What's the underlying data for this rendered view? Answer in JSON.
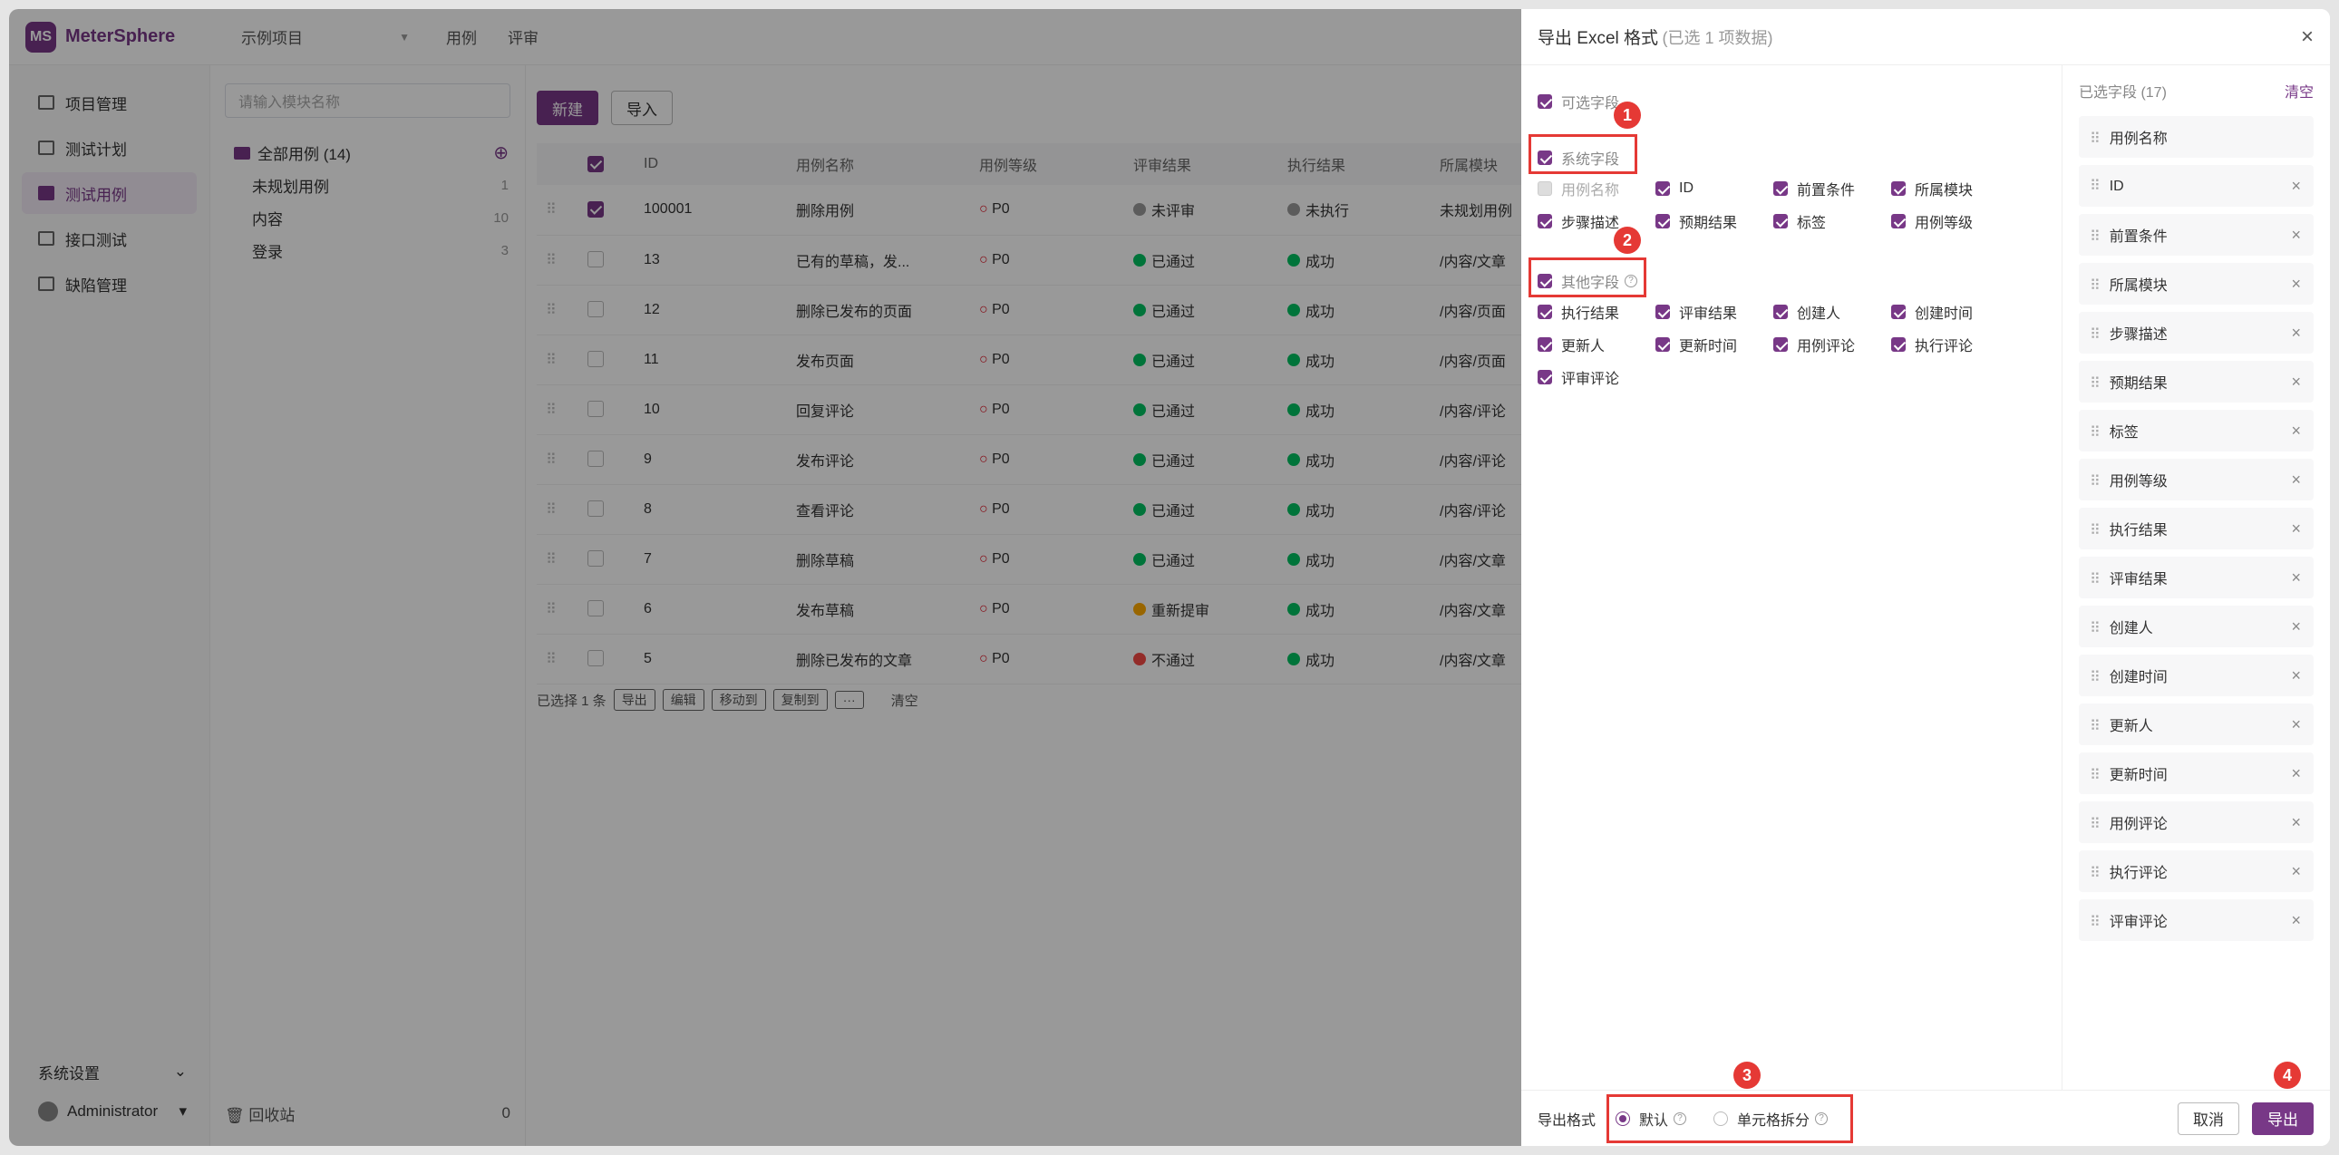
{
  "app": {
    "name": "MeterSphere",
    "logo_text": "MS"
  },
  "header": {
    "project": "示例项目",
    "tabs": [
      "用例",
      "评审"
    ]
  },
  "sidebar": {
    "items": [
      {
        "label": "项目管理",
        "active": false
      },
      {
        "label": "测试计划",
        "active": false
      },
      {
        "label": "测试用例",
        "active": true
      },
      {
        "label": "接口测试",
        "active": false
      },
      {
        "label": "缺陷管理",
        "active": false
      }
    ],
    "settings": "系统设置",
    "user": "Administrator"
  },
  "tree": {
    "search_placeholder": "请输入模块名称",
    "root": "全部用例",
    "root_count": "(14)",
    "nodes": [
      {
        "label": "未规划用例",
        "count": "1"
      },
      {
        "label": "内容",
        "count": "10"
      },
      {
        "label": "登录",
        "count": "3"
      }
    ],
    "recycle": "回收站",
    "recycle_count": "0"
  },
  "toolbar": {
    "new": "新建",
    "import": "导入"
  },
  "table": {
    "headers": [
      "ID",
      "用例名称",
      "用例等级",
      "评审结果",
      "执行结果",
      "所属模块"
    ],
    "rows": [
      {
        "id": "100001",
        "name": "删除用例",
        "level": "P0",
        "review": "未评审",
        "exec": "未执行",
        "module": "未规划用例",
        "checked": true,
        "review_color": "#999",
        "exec_color": "#999"
      },
      {
        "id": "13",
        "name": "已有的草稿，发...",
        "level": "P0",
        "review": "已通过",
        "exec": "成功",
        "module": "/内容/文章",
        "checked": false,
        "review_color": "#00c261",
        "exec_color": "#00c261"
      },
      {
        "id": "12",
        "name": "删除已发布的页面",
        "level": "P0",
        "review": "已通过",
        "exec": "成功",
        "module": "/内容/页面",
        "checked": false,
        "review_color": "#00c261",
        "exec_color": "#00c261"
      },
      {
        "id": "11",
        "name": "发布页面",
        "level": "P0",
        "review": "已通过",
        "exec": "成功",
        "module": "/内容/页面",
        "checked": false,
        "review_color": "#00c261",
        "exec_color": "#00c261"
      },
      {
        "id": "10",
        "name": "回复评论",
        "level": "P0",
        "review": "已通过",
        "exec": "成功",
        "module": "/内容/评论",
        "checked": false,
        "review_color": "#00c261",
        "exec_color": "#00c261"
      },
      {
        "id": "9",
        "name": "发布评论",
        "level": "P0",
        "review": "已通过",
        "exec": "成功",
        "module": "/内容/评论",
        "checked": false,
        "review_color": "#00c261",
        "exec_color": "#00c261"
      },
      {
        "id": "8",
        "name": "查看评论",
        "level": "P0",
        "review": "已通过",
        "exec": "成功",
        "module": "/内容/评论",
        "checked": false,
        "review_color": "#00c261",
        "exec_color": "#00c261"
      },
      {
        "id": "7",
        "name": "删除草稿",
        "level": "P0",
        "review": "已通过",
        "exec": "成功",
        "module": "/内容/文章",
        "checked": false,
        "review_color": "#00c261",
        "exec_color": "#00c261"
      },
      {
        "id": "6",
        "name": "发布草稿",
        "level": "P0",
        "review": "重新提审",
        "exec": "成功",
        "module": "/内容/文章",
        "checked": false,
        "review_color": "#ffaa00",
        "exec_color": "#00c261"
      },
      {
        "id": "5",
        "name": "删除已发布的文章",
        "level": "P0",
        "review": "不通过",
        "exec": "成功",
        "module": "/内容/文章",
        "checked": false,
        "review_color": "#f54a45",
        "exec_color": "#00c261"
      }
    ]
  },
  "batch": {
    "selected": "已选择 1 条",
    "actions": [
      "导出",
      "编辑",
      "移动到",
      "复制到",
      "···"
    ],
    "clear": "清空"
  },
  "drawer": {
    "title": "导出 Excel 格式",
    "subtitle": "(已选 1 项数据)",
    "optional": "可选字段",
    "system_group": "系统字段",
    "system_fields": [
      "用例名称",
      "ID",
      "前置条件",
      "所属模块",
      "步骤描述",
      "预期结果",
      "标签",
      "用例等级"
    ],
    "other_group": "其他字段",
    "other_fields": [
      "执行结果",
      "评审结果",
      "创建人",
      "创建时间",
      "更新人",
      "更新时间",
      "用例评论",
      "执行评论",
      "评审评论"
    ],
    "selected_title": "已选字段 (17)",
    "clear": "清空",
    "selected": [
      "用例名称",
      "ID",
      "前置条件",
      "所属模块",
      "步骤描述",
      "预期结果",
      "标签",
      "用例等级",
      "执行结果",
      "评审结果",
      "创建人",
      "创建时间",
      "更新人",
      "更新时间",
      "用例评论",
      "执行评论",
      "评审评论"
    ],
    "format_label": "导出格式",
    "format_default": "默认",
    "format_split": "单元格拆分",
    "cancel": "取消",
    "export": "导出",
    "badges": [
      "1",
      "2",
      "3",
      "4"
    ]
  },
  "colors": {
    "brand": "#783887",
    "annotation": "#e53935"
  }
}
